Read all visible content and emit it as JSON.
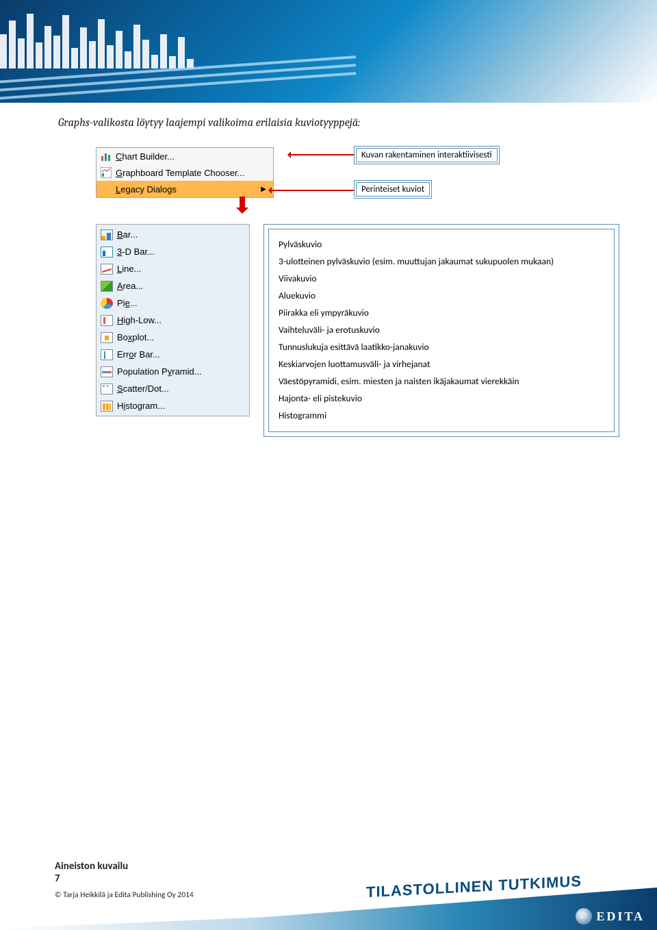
{
  "intro": "Graphs-valikosta löytyy laajempi valikoima erilaisia kuviotyyppejä:",
  "menu1": {
    "item1_prefix": "C",
    "item1_rest": "hart Builder...",
    "item2_prefix": "G",
    "item2_rest": "raphboard Template Chooser...",
    "item3_prefix": "L",
    "item3_rest": "egacy Dialogs"
  },
  "annot1": "Kuvan rakentaminen interaktiivisesti",
  "annot2": "Perinteiset kuviot",
  "menu2": {
    "bar_u": "B",
    "bar_rest": "ar...",
    "bar3d_u": "3",
    "bar3d_rest": "-D Bar...",
    "line_u": "L",
    "line_rest": "ine...",
    "area_u": "A",
    "area_rest": "rea...",
    "pie_pr": "Pi",
    "pie_u": "e",
    "pie_rest": "...",
    "hl_u": "H",
    "hl_rest": "igh-Low...",
    "box_pr": "Bo",
    "box_u": "x",
    "box_rest": "plot...",
    "err_pr": "Err",
    "err_u": "o",
    "err_rest": "r Bar...",
    "pyr_pr": "Population P",
    "pyr_u": "y",
    "pyr_rest": "ramid...",
    "scat_u": "S",
    "scat_rest": "catter/Dot...",
    "hist_pr": "H",
    "hist_u": "i",
    "hist_rest": "stogram..."
  },
  "desc": {
    "d1": "Pylväskuvio",
    "d2": "3-ulotteinen pylväskuvio (esim. muuttujan jakaumat sukupuolen mukaan)",
    "d3": "Viivakuvio",
    "d4": "Aluekuvio",
    "d5": "Piirakka eli ympyräkuvio",
    "d6": "Vaihteluväli- ja erotuskuvio",
    "d7": "Tunnuslukuja esittävä laatikko-janakuvio",
    "d8": "Keskiarvojen luottamusväli- ja virhejanat",
    "d9": "Väestöpyramidi, esim. miesten ja naisten ikäjakaumat vierekkäin",
    "d10": "Hajonta- eli pistekuvio",
    "d11": "Histogrammi"
  },
  "footer": {
    "section": "Aineiston kuvailu",
    "page": "7",
    "copyright": "© Tarja Heikkilä ja Edita Publishing Oy 2014",
    "series": "TILASTOLLINEN TUTKIMUS",
    "publisher": "EDITA"
  }
}
